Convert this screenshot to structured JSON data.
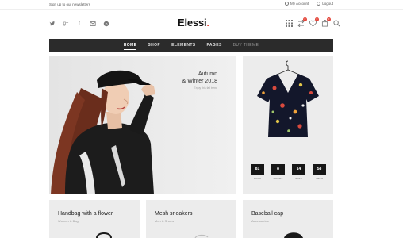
{
  "topbar": {
    "newsletter": "Sign up to our newsletters",
    "my_account": "My Account",
    "logout": "Logout"
  },
  "header": {
    "logo_text": "Elessi",
    "logo_dot": ".",
    "social_icons": [
      "twitter-icon",
      "google-plus-icon",
      "facebook-icon",
      "mail-icon",
      "pinterest-icon"
    ],
    "icons": [
      {
        "name": "grid-icon",
        "badge": ""
      },
      {
        "name": "compare-icon",
        "badge": "0"
      },
      {
        "name": "wishlist-heart-icon",
        "badge": "0"
      },
      {
        "name": "cart-bag-icon",
        "badge": "0"
      },
      {
        "name": "search-icon",
        "badge": ""
      }
    ]
  },
  "nav": {
    "items": [
      "HOME",
      "SHOP",
      "ELEMENTS",
      "PAGES",
      "BUY THEME"
    ],
    "active": "HOME"
  },
  "hero": {
    "title_line1": "Autumn",
    "title_line2": "& Winter 2018",
    "subtitle": "Enjoy this fall trend"
  },
  "promo": {
    "countdown": [
      {
        "value": "81",
        "label": "DAYS"
      },
      {
        "value": "8",
        "label": "HOURS"
      },
      {
        "value": "14",
        "label": "MINS"
      },
      {
        "value": "58",
        "label": "SECS"
      }
    ]
  },
  "categories": [
    {
      "name": "Handbag with a flower",
      "category": "Women & Bag"
    },
    {
      "name": "Mesh sneakers",
      "category": "Men & Shoes"
    },
    {
      "name": "Baseball cap",
      "category": "Accessories"
    }
  ],
  "colors": {
    "accent": "#e4453a",
    "nav_bg": "#2b2b2b",
    "panel_bg": "#ececec"
  }
}
